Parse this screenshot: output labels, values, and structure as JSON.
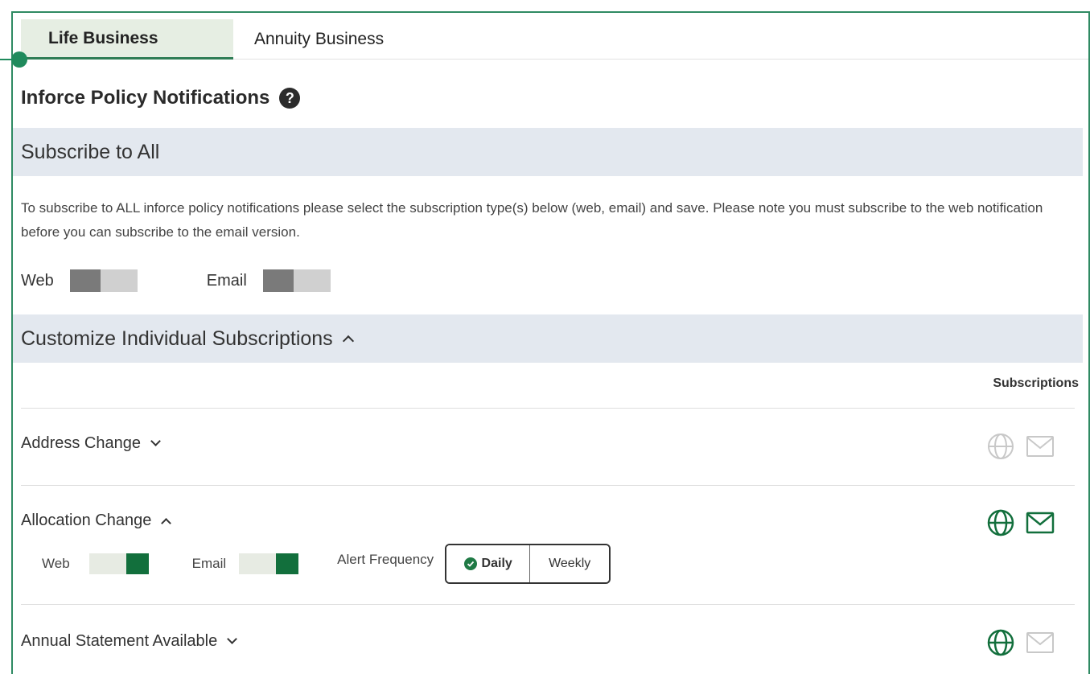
{
  "tabs": [
    {
      "label": "Life Business",
      "active": true
    },
    {
      "label": "Annuity Business",
      "active": false
    }
  ],
  "page_title": "Inforce Policy Notifications",
  "subscribe_all": {
    "heading": "Subscribe to All",
    "description": "To subscribe to ALL inforce policy notifications please select the subscription type(s) below (web, email) and save. Please note you must subscribe to the web notification before you can subscribe to the email version.",
    "web_label": "Web",
    "email_label": "Email",
    "web_enabled": false,
    "email_enabled": false
  },
  "customize": {
    "heading": "Customize Individual Subscriptions",
    "subscriptions_header": "Subscriptions",
    "items": [
      {
        "title": "Address Change",
        "expanded": false,
        "web": false,
        "email": false
      },
      {
        "title": "Allocation Change",
        "expanded": true,
        "web": true,
        "email": true,
        "detail": {
          "web_label": "Web",
          "email_label": "Email",
          "frequency_label": "Alert Frequency",
          "options": [
            "Daily",
            "Weekly"
          ],
          "selected": "Daily"
        }
      },
      {
        "title": "Annual Statement Available",
        "expanded": false,
        "web": true,
        "email": false
      }
    ]
  },
  "colors": {
    "accent": "#126f3c",
    "band": "#e3e8ef",
    "tab_active": "#e6eee3",
    "icon_off": "#c8c8c8",
    "frame": "#2f8a63"
  },
  "icons": {
    "help": "question-circle-icon",
    "web": "globe-icon",
    "email": "envelope-icon",
    "check": "check-circle-icon"
  }
}
